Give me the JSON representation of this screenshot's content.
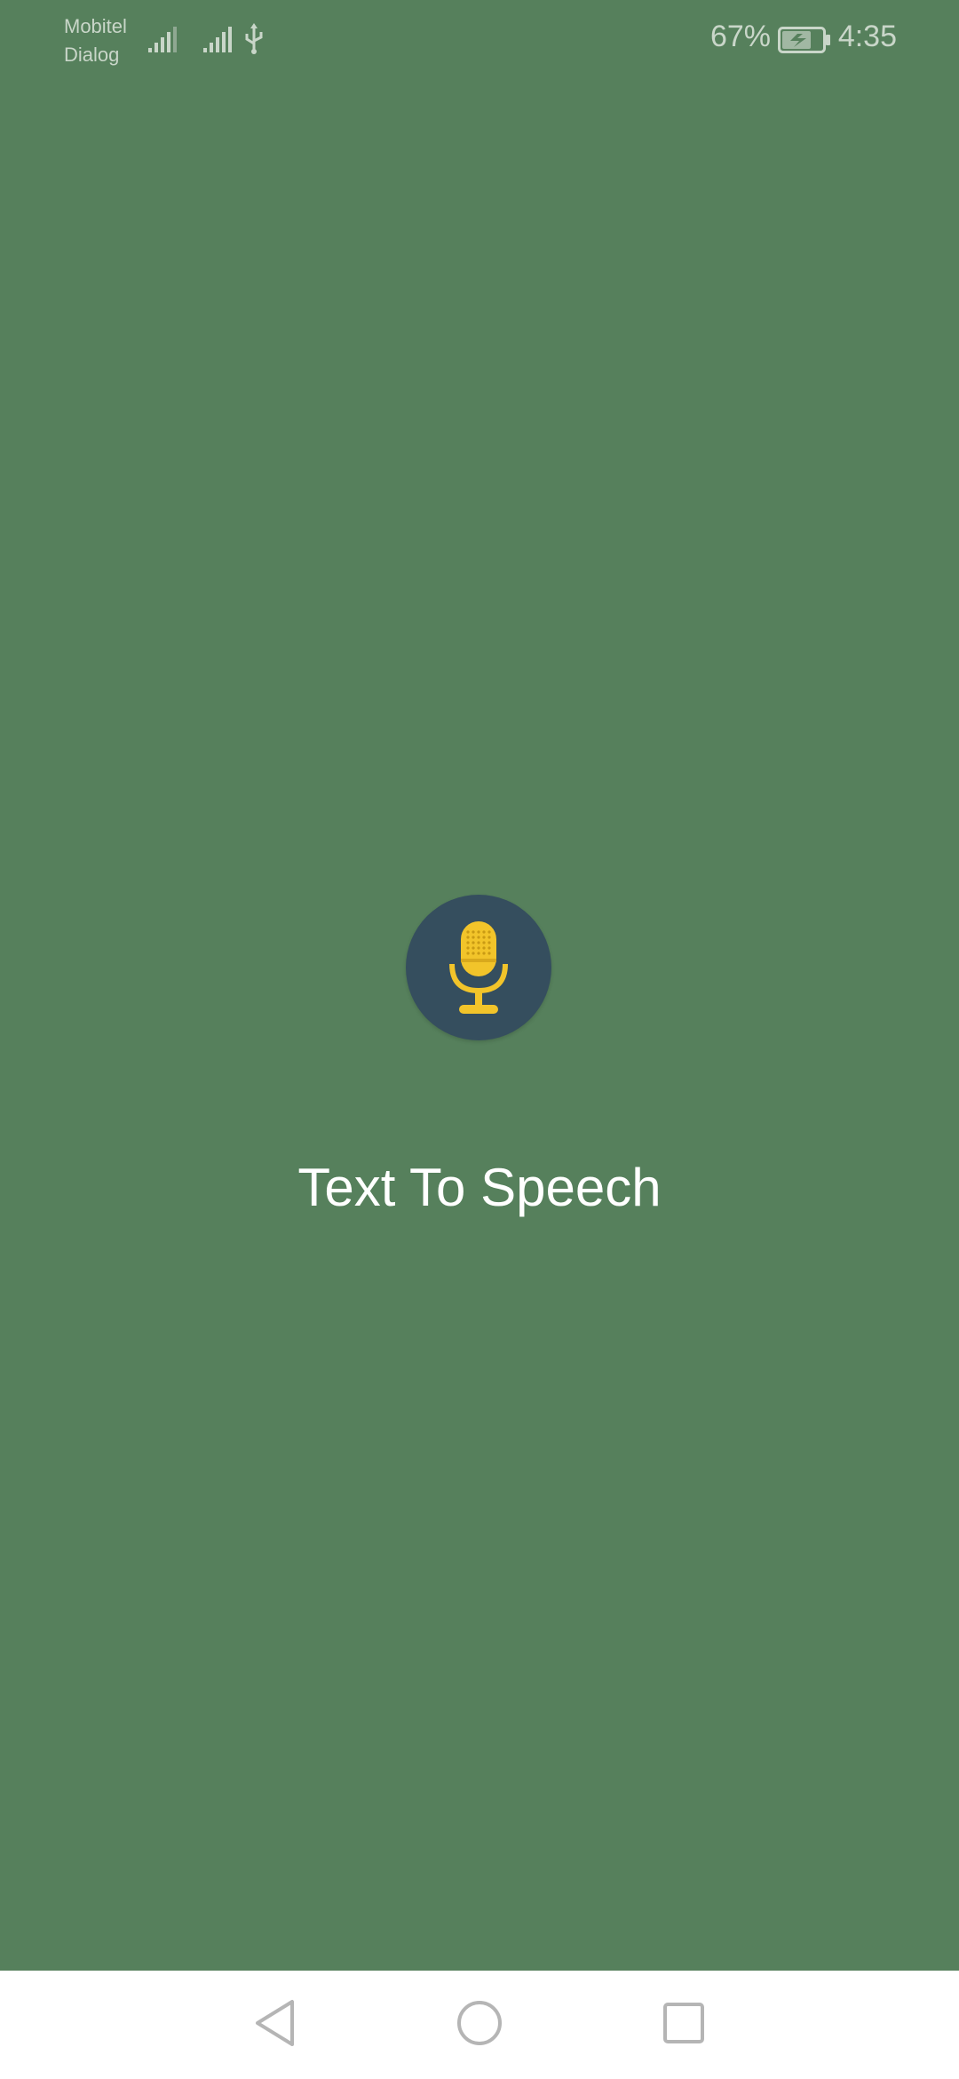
{
  "status_bar": {
    "carrier_1": "Mobitel",
    "carrier_2": "Dialog",
    "battery_percent": "67%",
    "time": "4:35",
    "battery_level": 0.67,
    "icons": [
      "signal-icon",
      "signal-icon",
      "usb-icon",
      "battery-charging-icon"
    ]
  },
  "main": {
    "title": "Text To Speech",
    "mic_icon": "microphone-icon"
  },
  "nav_bar": {
    "icons": [
      "back-icon",
      "home-icon",
      "recent-apps-icon"
    ]
  },
  "colors": {
    "background": "#56805c",
    "mic_circle": "#354e5e",
    "mic": "#f2c42a",
    "title": "#ffffff",
    "nav_bar": "#ffffff"
  }
}
